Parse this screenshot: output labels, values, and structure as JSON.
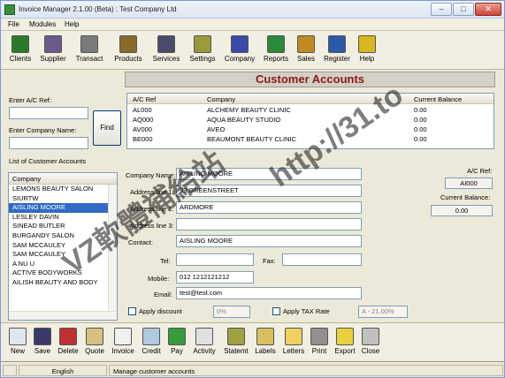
{
  "window": {
    "title": "Invoice Manager 2.1.00 (Beta) : Test Company Ltd",
    "controls": {
      "minimize": "–",
      "maximize": "□",
      "close": "✕"
    }
  },
  "menu": [
    "File",
    "Modules",
    "Help"
  ],
  "toolbar": [
    {
      "label": "Clients",
      "icon": "clients-icon",
      "color": "#2b7a2b"
    },
    {
      "label": "Supplier",
      "icon": "supplier-icon",
      "color": "#6b5a8a"
    },
    {
      "label": "Transact",
      "icon": "transact-icon",
      "color": "#7a7a7a"
    },
    {
      "label": "Products",
      "icon": "products-icon",
      "color": "#8a6a2a"
    },
    {
      "label": "Services",
      "icon": "services-icon",
      "color": "#4a4a6a"
    },
    {
      "label": "Settings",
      "icon": "settings-icon",
      "color": "#9a9a3a"
    },
    {
      "label": "Company",
      "icon": "company-icon",
      "color": "#3a4aa8"
    },
    {
      "label": "Reports",
      "icon": "reports-icon",
      "color": "#2a8a3a"
    },
    {
      "label": "Sales",
      "icon": "sales-icon",
      "color": "#c08a20"
    },
    {
      "label": "Register",
      "icon": "register-icon",
      "color": "#2a5aa8"
    },
    {
      "label": "Help",
      "icon": "help-icon",
      "color": "#d8b820"
    }
  ],
  "search": {
    "ac_ref_label": "Enter A/C Ref:",
    "ac_ref_value": "",
    "company_label": "Enter Company Name:",
    "company_value": "",
    "find_label": "Find",
    "list_label": "List of Customer Accounts",
    "list_header": "Company",
    "list_items": [
      "LEMONS BEAUTY SALON",
      "SIURTW",
      "AISLING MOORE",
      "LESLEY DAVIN",
      "SINEAD BUTLER",
      "BURGANDY SALON",
      "SAM MCCAULEY",
      "SAM MCCAULEY",
      "A NU U",
      "ACTIVE BODYWORKS",
      "AILISH BEAUTY AND BODY"
    ],
    "selected_index": 2
  },
  "banner": "Customer Accounts",
  "grid": {
    "columns": [
      "A/C Ref",
      "Company",
      "Current Balance"
    ],
    "rows": [
      [
        "AL000",
        "ALCHEMY BEAUTY CLINIC",
        "0.00"
      ],
      [
        "AQ000",
        "AQUA BEAUTY STUDIO",
        "0.00"
      ],
      [
        "AV000",
        "AVEO",
        "0.00"
      ],
      [
        "BE000",
        "BEAUMONT BEAUTY CLINIC",
        "0.00"
      ]
    ]
  },
  "detail": {
    "company_name_label": "Company Name:",
    "company_name": "AISLING MOORE",
    "address1_label": "Address line 1:",
    "address1": "99 GREENSTREET",
    "address2_label": "Address line 2:",
    "address2": "ARDMORE",
    "address3_label": "Address line 3:",
    "address3": "",
    "contact_label": "Contact:",
    "contact": "AISLING MOORE",
    "tel_label": "Tel:",
    "tel": "",
    "fax_label": "Fax:",
    "fax": "",
    "mobile_label": "Mobile:",
    "mobile": "012 1212121212",
    "email_label": "Email:",
    "email": "test@test.com",
    "apply_discount_label": "Apply discount",
    "discount_value": "0%",
    "apply_tax_label": "Apply TAX Rate",
    "tax_value": "A - 21.00%",
    "ac_ref_label": "A/C Ref:",
    "ac_ref": "AI000",
    "balance_label": "Current Balance:",
    "balance": "0.00"
  },
  "actions": [
    {
      "label": "New",
      "icon": "new-icon",
      "color": "#dfe6f2"
    },
    {
      "label": "Save",
      "icon": "save-icon",
      "color": "#3a3a6a"
    },
    {
      "label": "Delete",
      "icon": "delete-icon",
      "color": "#c03030"
    },
    {
      "label": "Quote",
      "icon": "quote-icon",
      "color": "#d8c080"
    },
    {
      "label": "Invoice",
      "icon": "invoice-icon",
      "color": "#f0f0f0"
    },
    {
      "label": "Credit",
      "icon": "credit-icon",
      "color": "#b0c8e0"
    },
    {
      "label": "Pay",
      "icon": "pay-icon",
      "color": "#3a9a3a"
    },
    {
      "label": "Activity",
      "icon": "activity-icon",
      "color": "#e0e0e0"
    },
    {
      "label": "Statemt",
      "icon": "statement-icon",
      "color": "#a0a040"
    },
    {
      "label": "Labels",
      "icon": "labels-icon",
      "color": "#d8c060"
    },
    {
      "label": "Letters",
      "icon": "letters-icon",
      "color": "#f0d060"
    },
    {
      "label": "Print",
      "icon": "print-icon",
      "color": "#909090"
    },
    {
      "label": "Export",
      "icon": "export-icon",
      "color": "#e8d040"
    },
    {
      "label": "Close",
      "icon": "close-icon",
      "color": "#c0c0c0"
    }
  ],
  "status": {
    "language": "English",
    "message": "Manage customer accounts"
  },
  "watermark": {
    "left": "VZ軟體補給站",
    "right": "http://31.to"
  }
}
